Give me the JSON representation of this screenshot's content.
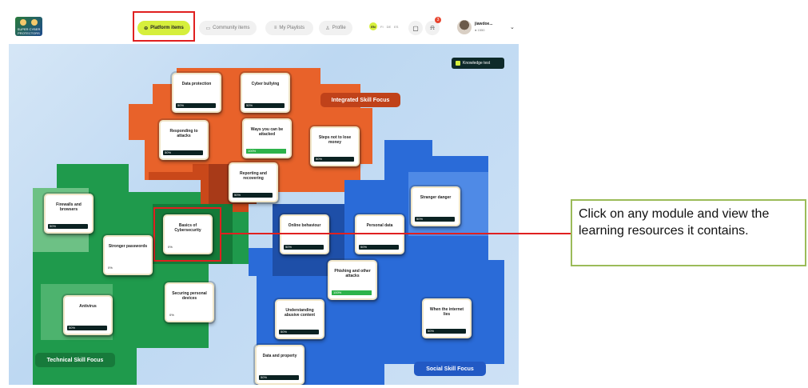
{
  "app": {
    "logo_text": "SUPER CYBER PROTECTORS",
    "nav": {
      "platform_items": "Platform items",
      "community_items": "Community items",
      "my_playlists": "My Playlists",
      "profile": "Profile"
    },
    "lang": {
      "active": "EN",
      "others": [
        "FI",
        "DE",
        "ES"
      ]
    },
    "notification_count": "3",
    "user": {
      "name": "jiawdoe...",
      "coins": "1550"
    },
    "knowledge_test": "Knowledge test"
  },
  "regions": {
    "integrated": "Integrated Skill Focus",
    "technical": "Technical Skill Focus",
    "social": "Social Skill Focus"
  },
  "modules": [
    {
      "title": "Data protection",
      "progress": "50%"
    },
    {
      "title": "Cyber bullying",
      "progress": "50%"
    },
    {
      "title": "Responding to attacks",
      "progress": "50%"
    },
    {
      "title": "Ways you can be attacked",
      "progress": "100%"
    },
    {
      "title": "Steps not to lose money",
      "progress": "50%"
    },
    {
      "title": "Reporting and recovering",
      "progress": "50%"
    },
    {
      "title": "Firewalls and browsers",
      "progress": "50%"
    },
    {
      "title": "Basics of Cybersecurity",
      "progress": "0%"
    },
    {
      "title": "Stronger passwords",
      "progress": "0%"
    },
    {
      "title": "Securing personal devices",
      "progress": "0%"
    },
    {
      "title": "Antivirus",
      "progress": "50%"
    },
    {
      "title": "Stranger danger",
      "progress": "50%"
    },
    {
      "title": "Online behaviour",
      "progress": "50%"
    },
    {
      "title": "Personal data",
      "progress": "50%"
    },
    {
      "title": "Phishing and other attacks",
      "progress": "100%"
    },
    {
      "title": "Understanding abusive content",
      "progress": "50%"
    },
    {
      "title": "When the internet lies",
      "progress": "50%"
    },
    {
      "title": "Data and property",
      "progress": "50%"
    }
  ],
  "callout": {
    "text": "Click on any module and view the learning resources it contains."
  },
  "colors": {
    "accent": "#d6ef3c",
    "integrated": "#e8622a",
    "technical": "#1f9a4c",
    "social": "#2a6bd8",
    "highlight": "#e02020"
  }
}
